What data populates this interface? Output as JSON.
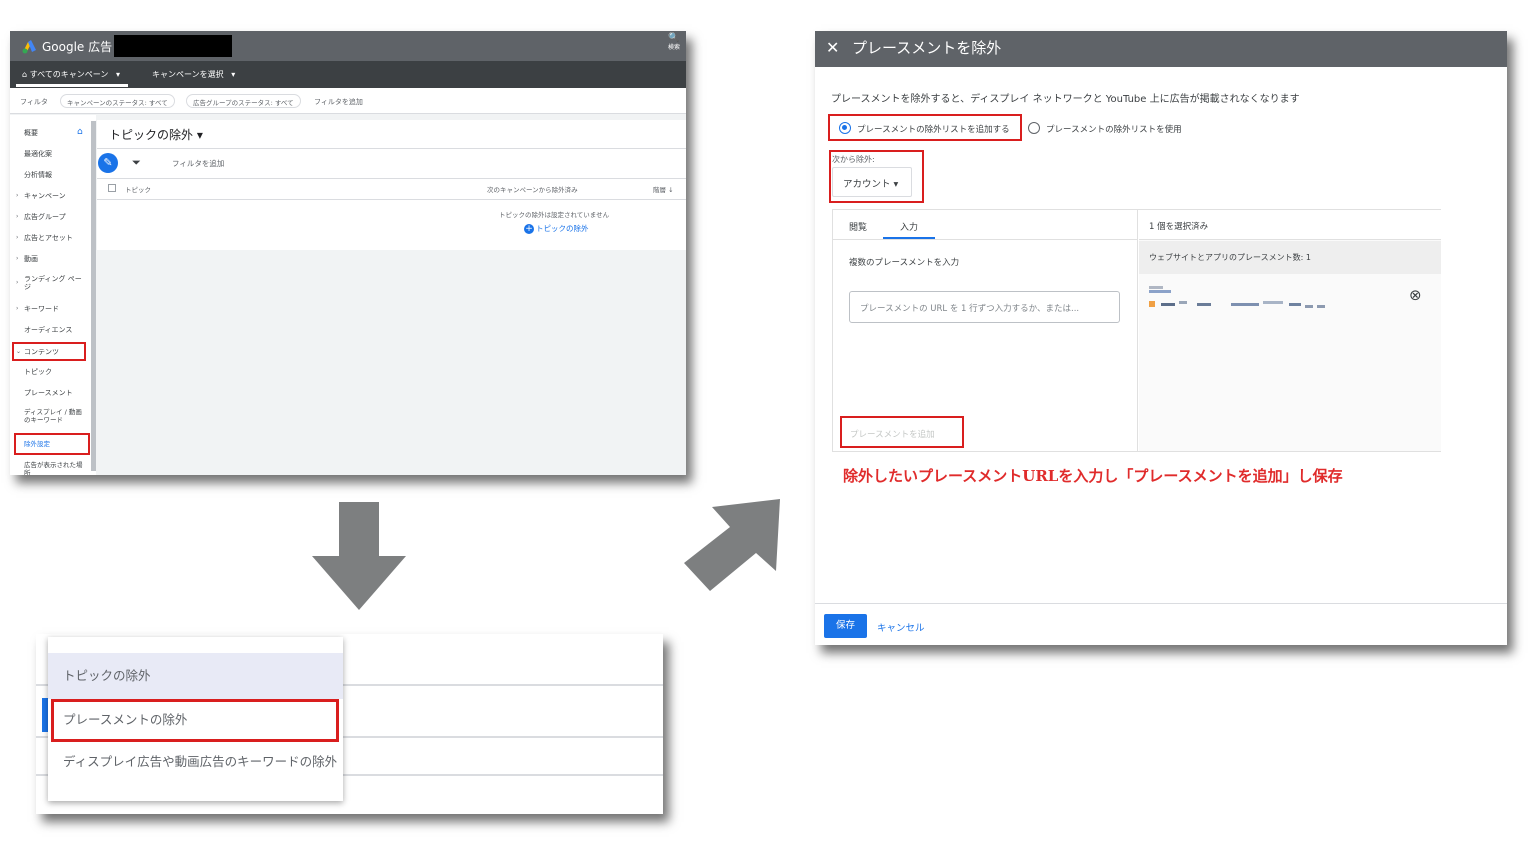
{
  "screenshot1": {
    "brand": "Google 広告",
    "search_label": "検索",
    "nav": {
      "all_campaigns": "すべてのキャンペーン",
      "select_campaign": "キャンペーンを選択"
    },
    "filter_bar": {
      "label": "フィルタ",
      "chip1": "キャンペーンのステータス: すべて",
      "chip2": "広告グループのステータス: すべて",
      "add": "フィルタを追加"
    },
    "sidebar": {
      "items": [
        "概要",
        "最適化案",
        "分析情報",
        "キャンペーン",
        "広告グループ",
        "広告とアセット",
        "動画",
        "ランディング ページ",
        "キーワード",
        "オーディエンス",
        "コンテンツ",
        "トピック",
        "プレースメント",
        "ディスプレイ / 動画のキーワード",
        "除外設定",
        "広告が表示された場所"
      ]
    },
    "main": {
      "title": "トピックの除外",
      "add_filter": "フィルタを追加",
      "col_topic": "トピック",
      "col_excluded_from": "次のキャンペーンから除外済み",
      "col_level": "階層",
      "empty_message": "トピックの除外は設定されていません",
      "add_topic": "トピックの除外"
    }
  },
  "screenshot2": {
    "menu": [
      "トピックの除外",
      "プレースメントの除外",
      "ディスプレイ広告や動画広告のキーワードの除外"
    ]
  },
  "screenshot3": {
    "header_title": "プレースメントを除外",
    "description": "プレースメントを除外すると、ディスプレイ ネットワークと YouTube 上に広告が掲載されなくなります",
    "radio_add_list": "プレースメントの除外リストを追加する",
    "radio_use_list": "プレースメントの除外リストを使用",
    "from_label": "次から除外:",
    "from_value": "アカウント",
    "tab_browse": "閲覧",
    "tab_enter": "入力",
    "multi_label": "複数のプレースメントを入力",
    "textarea_placeholder": "プレースメントの URL を 1 行ずつ入力するか、または...",
    "add_button": "プレースメントを追加",
    "selected_count": "1 個を選択済み",
    "selected_sub": "ウェブサイトとアプリのプレースメント数: 1",
    "instruction": "除外したいプレースメントURLを入力し「プレースメントを追加」し保存",
    "save": "保存",
    "cancel": "キャンセル"
  },
  "colors": {
    "highlight_red": "#d91e1e",
    "accent_blue": "#1a73e8",
    "arrow_gray": "#7d7f80"
  }
}
